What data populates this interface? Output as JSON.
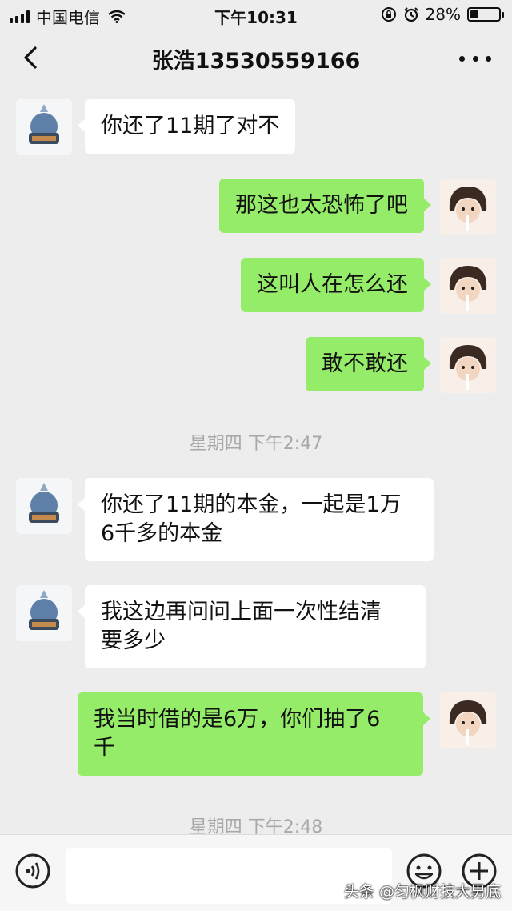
{
  "status_bar": {
    "carrier": "中国电信",
    "time": "下午10:31",
    "battery": "28%",
    "battery_level": 0.28
  },
  "header": {
    "title": "张浩13530559166",
    "back_icon": "chevron-left-icon",
    "more_icon": "more-dots-icon"
  },
  "messages": [
    {
      "side": "in",
      "text": "你还了11期了对不"
    },
    {
      "side": "out",
      "text": "那这也太恐怖了吧"
    },
    {
      "side": "out",
      "text": "这叫人在怎么还"
    },
    {
      "side": "out",
      "text": "敢不敢还"
    },
    {
      "side": "time",
      "text": "星期四 下午2:47"
    },
    {
      "side": "in",
      "text": "你还了11期的本金，一起是1万\n6千多的本金"
    },
    {
      "side": "in",
      "text": "我这边再问问上面一次性结清\n要多少"
    },
    {
      "side": "out",
      "text": "我当时借的是6万，你们抽了6\n千"
    },
    {
      "side": "time",
      "text": "星期四 下午2:48"
    }
  ],
  "input_bar": {
    "voice_icon": "voice-icon",
    "emoji_icon": "emoji-icon",
    "plus_icon": "plus-icon"
  },
  "watermark": "头条 @匀枫财技大男底",
  "colors": {
    "background": "#ededed",
    "outgoing_bubble": "#95ec69",
    "incoming_bubble": "#ffffff",
    "timestamp": "#a8a8a8"
  }
}
